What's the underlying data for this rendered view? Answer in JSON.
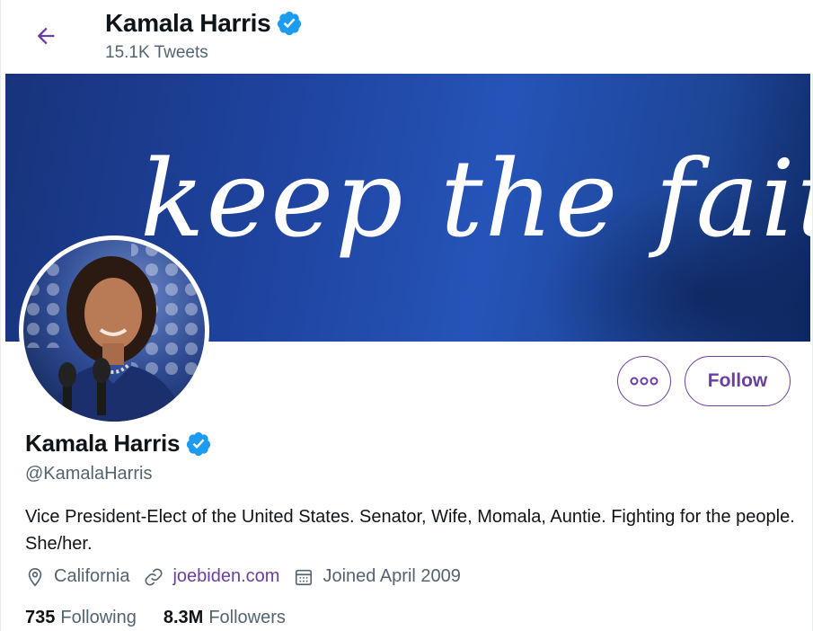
{
  "header": {
    "name": "Kamala Harris",
    "tweets_count": "15.1K Tweets",
    "back_icon": "arrow-left-icon"
  },
  "banner": {
    "text": "keep the faith!"
  },
  "actions": {
    "more_icon": "more-options-icon",
    "follow_label": "Follow"
  },
  "profile": {
    "name": "Kamala Harris",
    "handle": "@KamalaHarris",
    "bio": "Vice President-Elect of the United States. Senator, Wife, Momala, Auntie. Fighting for the people. She/her.",
    "location": "California",
    "website": "joebiden.com",
    "joined": "Joined April 2009"
  },
  "stats": {
    "following_count": "735",
    "following_label": "Following",
    "followers_count": "8.3M",
    "followers_label": "Followers"
  },
  "colors": {
    "accent": "#6b3fa0",
    "verified": "#1d9bf0",
    "banner": "#2554b8",
    "muted_text": "#536471"
  }
}
